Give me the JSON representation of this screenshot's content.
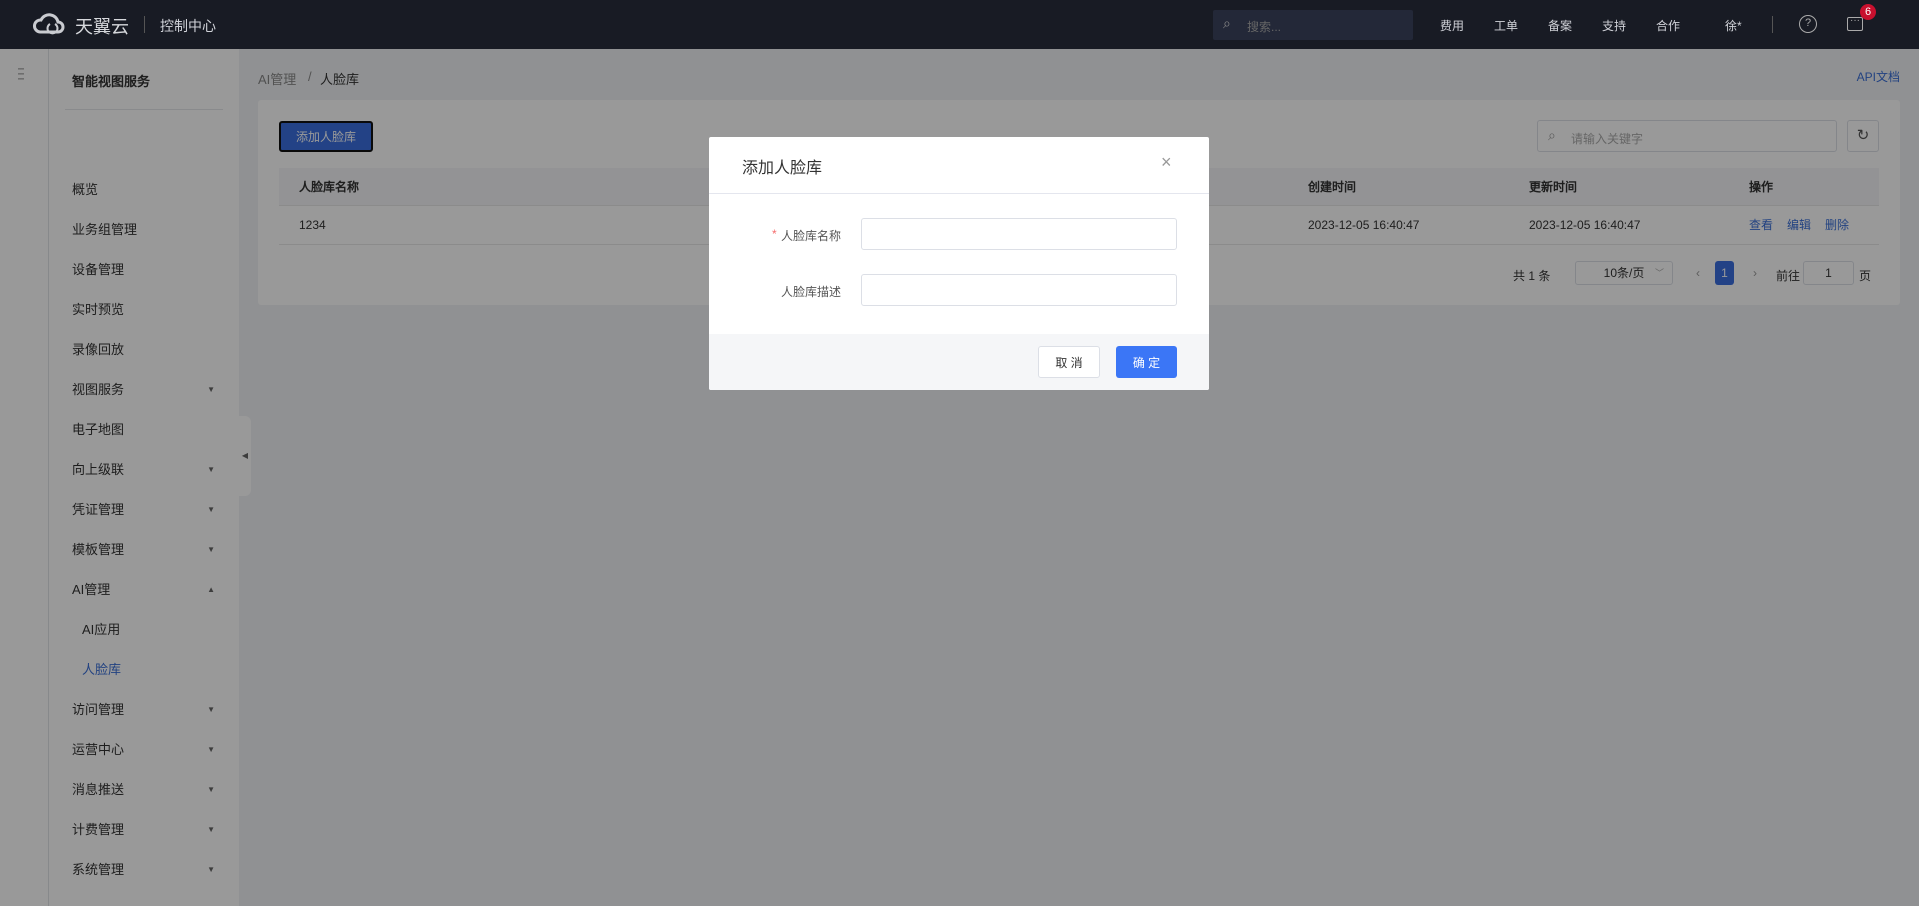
{
  "topbar": {
    "brand": "天翼云",
    "console": "控制中心",
    "search_placeholder": "搜索...",
    "nav": [
      "费用",
      "工单",
      "备案",
      "支持",
      "合作"
    ],
    "user": "徐*",
    "message_badge": "6"
  },
  "sidebar": {
    "title": "智能视图服务",
    "items": [
      {
        "label": "概览",
        "arrow": ""
      },
      {
        "label": "业务组管理",
        "arrow": ""
      },
      {
        "label": "设备管理",
        "arrow": ""
      },
      {
        "label": "实时预览",
        "arrow": ""
      },
      {
        "label": "录像回放",
        "arrow": ""
      },
      {
        "label": "视图服务",
        "arrow": "down"
      },
      {
        "label": "电子地图",
        "arrow": ""
      },
      {
        "label": "向上级联",
        "arrow": "down"
      },
      {
        "label": "凭证管理",
        "arrow": "down"
      },
      {
        "label": "模板管理",
        "arrow": "down"
      },
      {
        "label": "AI管理",
        "arrow": "up"
      },
      {
        "label": "AI应用",
        "arrow": "",
        "sub": true
      },
      {
        "label": "人脸库",
        "arrow": "",
        "sub": true,
        "active": true
      },
      {
        "label": "访问管理",
        "arrow": "down"
      },
      {
        "label": "运营中心",
        "arrow": "down"
      },
      {
        "label": "消息推送",
        "arrow": "down"
      },
      {
        "label": "计费管理",
        "arrow": "down"
      },
      {
        "label": "系统管理",
        "arrow": "down"
      }
    ]
  },
  "breadcrumb": {
    "parent": "AI管理",
    "sep": "/",
    "current": "人脸库"
  },
  "api_doc": "API文档",
  "toolbar": {
    "add_label": "添加人脸库",
    "search_placeholder": "请输入关键字"
  },
  "table": {
    "headers": [
      "人脸库名称",
      "创建时间",
      "更新时间",
      "操作"
    ],
    "rows": [
      {
        "name": "1234",
        "created": "2023-12-05 16:40:47",
        "updated": "2023-12-05 16:40:47",
        "actions": [
          "查看",
          "编辑",
          "删除"
        ]
      }
    ]
  },
  "pagination": {
    "total": "共 1 条",
    "page_size": "10条/页",
    "current_page": "1",
    "goto_label": "前往",
    "goto_value": "1",
    "page_suffix": "页"
  },
  "dialog": {
    "title": "添加人脸库",
    "required_mark": "*",
    "name_label": "人脸库名称",
    "name_value": "",
    "desc_label": "人脸库描述",
    "desc_value": "",
    "cancel": "取 消",
    "confirm": "确 定"
  },
  "colors": {
    "primary": "#3b76f6",
    "link": "#3a6fd8",
    "topbar": "#181b24",
    "badge": "#c8102e"
  }
}
